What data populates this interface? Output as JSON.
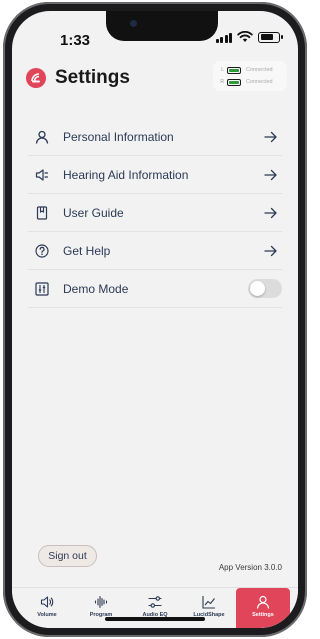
{
  "status_bar": {
    "time": "1:33",
    "battery_level": 0.8
  },
  "header": {
    "title": "Settings",
    "logo_color": "#e0455a"
  },
  "connection": [
    {
      "side": "L",
      "status": "Connected"
    },
    {
      "side": "R",
      "status": "Connected"
    }
  ],
  "menu": {
    "items": [
      {
        "label": "Personal Information",
        "icon": "person-icon"
      },
      {
        "label": "Hearing Aid Information",
        "icon": "speaker-icon"
      },
      {
        "label": "User Guide",
        "icon": "book-icon"
      },
      {
        "label": "Get Help",
        "icon": "help-icon"
      }
    ],
    "demo_mode": {
      "label": "Demo Mode",
      "icon": "sliders-icon",
      "enabled": false
    }
  },
  "footer": {
    "sign_out": "Sign out",
    "app_version": "App Version 3.0.0"
  },
  "tabs": [
    {
      "label": "Volume",
      "icon": "volume-icon",
      "active": false
    },
    {
      "label": "Program",
      "icon": "waveform-icon",
      "active": false
    },
    {
      "label": "Audio EQ",
      "icon": "eq-icon",
      "active": false
    },
    {
      "label": "LucidShape",
      "icon": "chart-icon",
      "active": false
    },
    {
      "label": "Settings",
      "icon": "person-icon",
      "active": true
    }
  ],
  "colors": {
    "accent": "#e0455a",
    "text": "#2b3a55",
    "background": "#f2f2f2"
  }
}
